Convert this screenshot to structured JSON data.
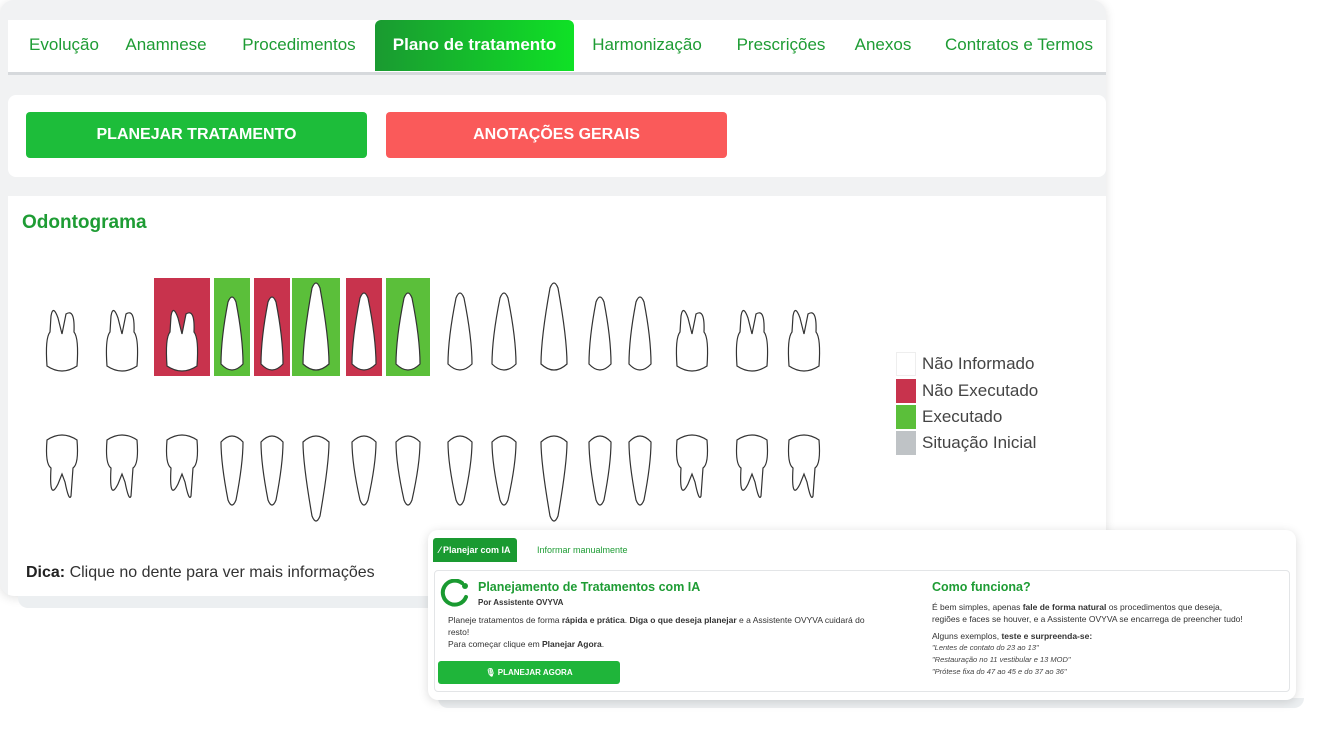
{
  "tabs": [
    {
      "label": "Evolução"
    },
    {
      "label": "Anamnese"
    },
    {
      "label": "Procedimentos"
    },
    {
      "label": "Plano de tratamento",
      "active": true
    },
    {
      "label": "Harmonização"
    },
    {
      "label": "Prescrições"
    },
    {
      "label": "Anexos"
    },
    {
      "label": "Contratos e Termos"
    }
  ],
  "buttons": {
    "plan_label": "PLANEJAR TRATAMENTO",
    "plan_color": "#1dbd3a",
    "notes_label": "ANOTAÇÕES GERAIS",
    "notes_color": "#fa5a5a"
  },
  "odontogram": {
    "title": "Odontograma",
    "upper_teeth": [
      {
        "type": "molar",
        "status": "none"
      },
      {
        "type": "molar",
        "status": "none"
      },
      {
        "type": "molar",
        "status": "not_executed"
      },
      {
        "type": "premolar",
        "status": "executed"
      },
      {
        "type": "premolar",
        "status": "not_executed"
      },
      {
        "type": "canine",
        "status": "executed"
      },
      {
        "type": "incisor",
        "status": "not_executed"
      },
      {
        "type": "incisor",
        "status": "executed"
      },
      {
        "type": "incisor",
        "status": "none"
      },
      {
        "type": "incisor",
        "status": "none"
      },
      {
        "type": "canine",
        "status": "none"
      },
      {
        "type": "premolar",
        "status": "none"
      },
      {
        "type": "premolar",
        "status": "none"
      },
      {
        "type": "molar",
        "status": "none"
      },
      {
        "type": "molar",
        "status": "none"
      },
      {
        "type": "molar",
        "status": "none"
      }
    ],
    "lower_teeth": [
      {
        "type": "molar",
        "status": "none"
      },
      {
        "type": "molar",
        "status": "none"
      },
      {
        "type": "molar",
        "status": "none"
      },
      {
        "type": "premolar",
        "status": "none"
      },
      {
        "type": "premolar",
        "status": "none"
      },
      {
        "type": "canine",
        "status": "none"
      },
      {
        "type": "incisor",
        "status": "none"
      },
      {
        "type": "incisor",
        "status": "none"
      },
      {
        "type": "incisor",
        "status": "none"
      },
      {
        "type": "incisor",
        "status": "none"
      },
      {
        "type": "canine",
        "status": "none"
      },
      {
        "type": "premolar",
        "status": "none"
      },
      {
        "type": "premolar",
        "status": "none"
      },
      {
        "type": "molar",
        "status": "none"
      },
      {
        "type": "molar",
        "status": "none"
      },
      {
        "type": "molar",
        "status": "none"
      }
    ],
    "status_colors": {
      "none": "#ffffff",
      "not_executed": "#c8334d",
      "executed": "#5bbf3a",
      "initial": "#bfc3c6"
    },
    "legend": [
      {
        "label": "Não Informado",
        "color": "#ffffff"
      },
      {
        "label": "Não Executado",
        "color": "#c8334d"
      },
      {
        "label": "Executado",
        "color": "#5bbf3a"
      },
      {
        "label": "Situação Inicial",
        "color": "#bfc3c6"
      }
    ],
    "tip_bold": "Dica:",
    "tip_text": " Clique no dente para ver mais informações"
  },
  "ai_panel": {
    "tab_active": "Planejar com IA",
    "tab_other": "Informar manualmente",
    "title": "Planejamento de Tratamentos com IA",
    "subtitle": "Por Assistente OVYVA",
    "desc_1": "Planeje tratamentos de forma ",
    "desc_bold_1": "rápida e prática",
    "desc_2": ". ",
    "desc_bold_2": "Diga o que deseja planejar",
    "desc_3": " e a Assistente OVYVA cuidará do",
    "desc_4": "resto!",
    "start_1": "Para começar clique em ",
    "start_bold": "Planejar Agora",
    "start_2": ".",
    "button_label": "PLANEJAR AGORA",
    "how_title": "Como funciona?",
    "how_1": "É bem simples, apenas ",
    "how_bold": "fale de forma natural",
    "how_2": " os procedimentos que deseja,",
    "how_3": "regiões e faces se houver, e a Assistente OVYVA se encarrega de preencher tudo!",
    "examples_1": "Alguns exemplos, ",
    "examples_bold": "teste e surpreenda-se:",
    "examples": [
      "\"Lentes de contato do 23 ao 13\"",
      "\"Restauração no 11 vestibular e 13 MOD\"",
      "\"Prótese fixa do 47 ao 45 e do 37 ao 36\""
    ]
  }
}
